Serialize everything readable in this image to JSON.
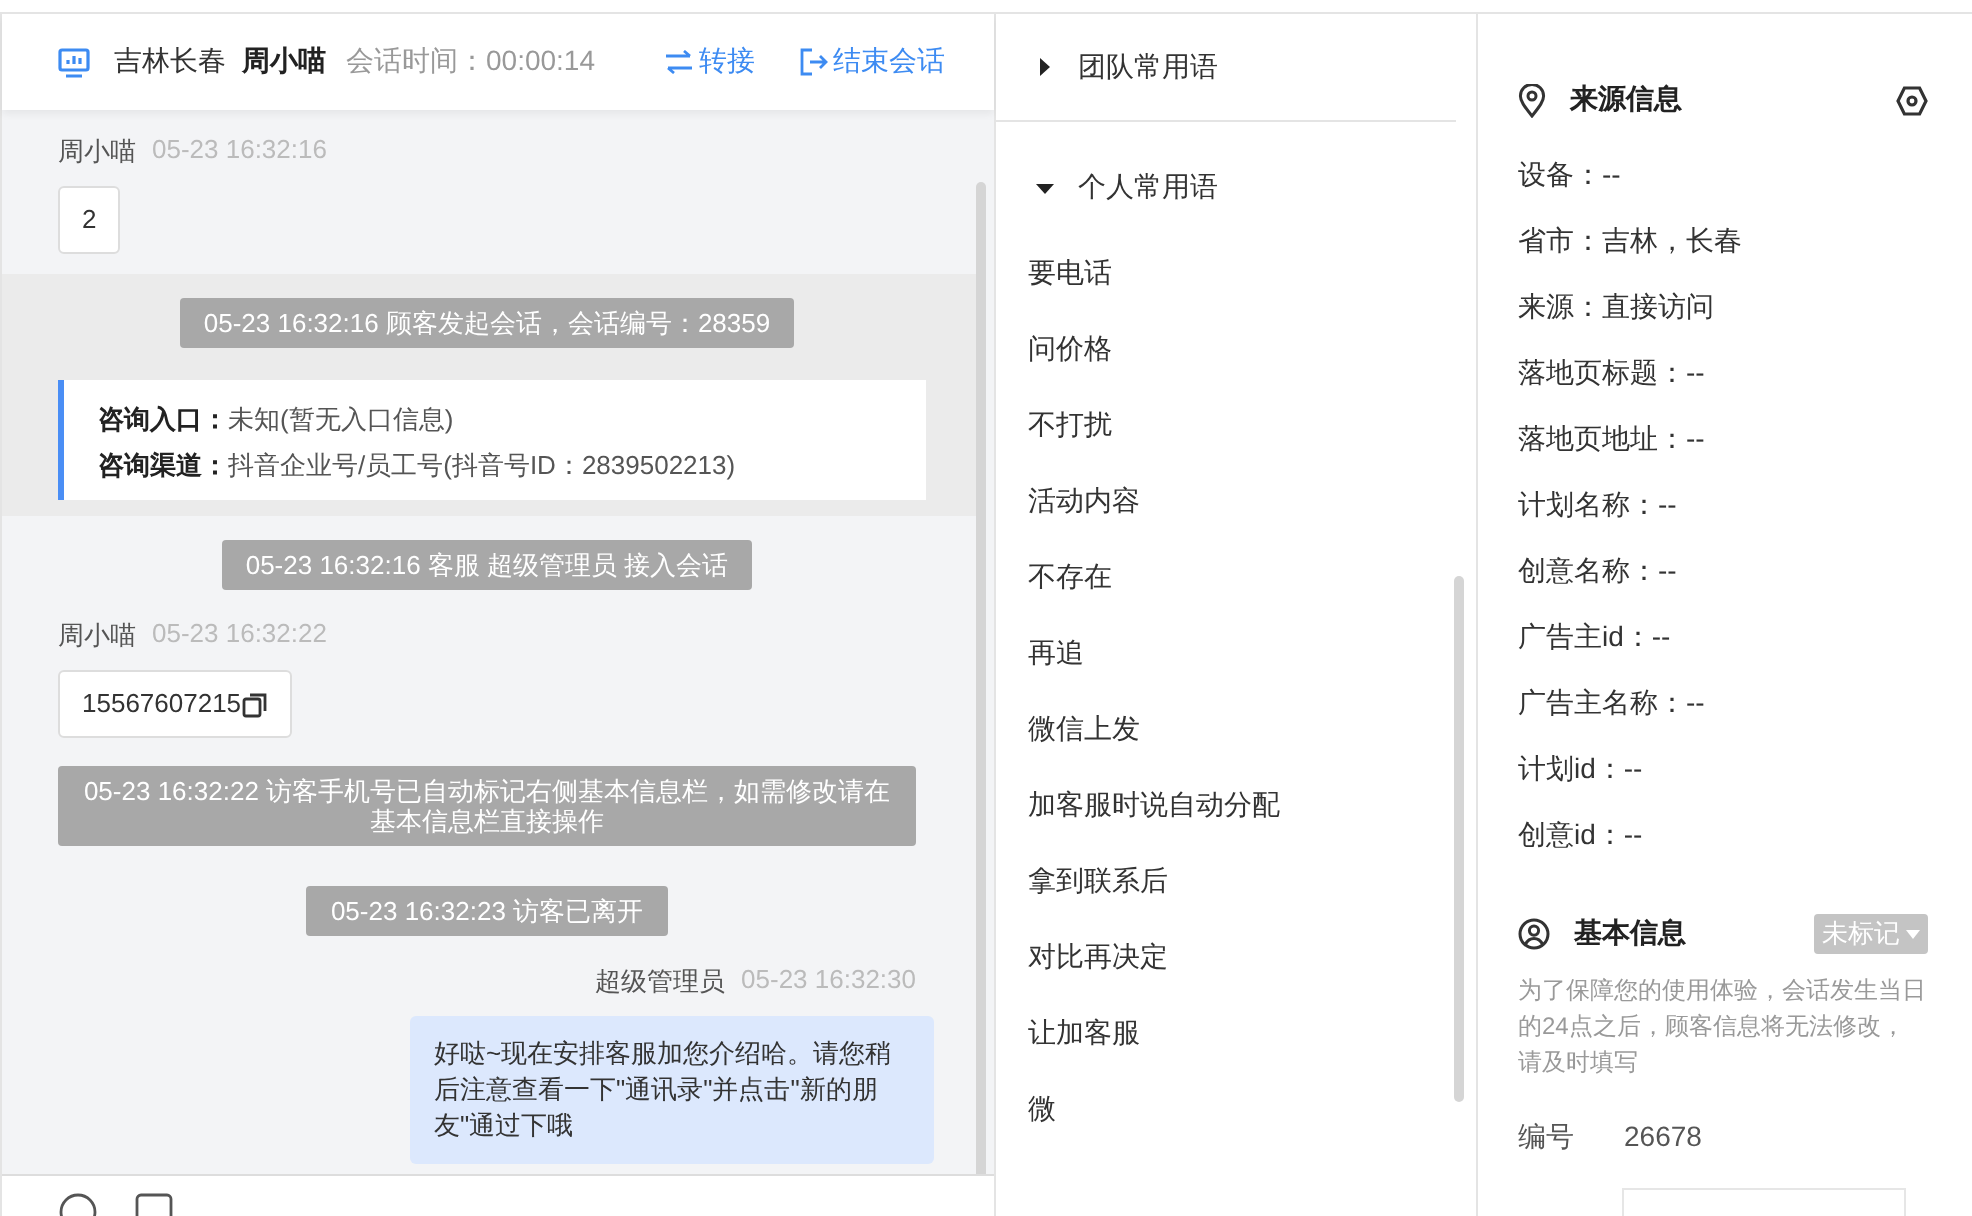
{
  "header": {
    "location": "吉林长春",
    "visitor": "周小喵",
    "duration_label": "会话时间：",
    "duration": "00:00:14",
    "actions": [
      {
        "kind": "transfer",
        "label": "转接"
      },
      {
        "kind": "end",
        "label": "结束会话"
      }
    ]
  },
  "messages": [
    {
      "kind": "customer",
      "sender": "周小喵",
      "time": "05-23 16:32:16",
      "text": "2",
      "copyable": false
    },
    {
      "kind": "session_start",
      "text": "05-23 16:32:16 顾客发起会话，会话编号：28359",
      "rows": [
        {
          "label": "咨询入口：",
          "value": "未知(暂无入口信息)"
        },
        {
          "label": "咨询渠道：",
          "value": "抖音企业号/员工号(抖音号ID：2839502213)"
        }
      ]
    },
    {
      "kind": "system",
      "text": "05-23 16:32:16 客服 超级管理员 接入会话"
    },
    {
      "kind": "customer",
      "sender": "周小喵",
      "time": "05-23 16:32:22",
      "text": "15567607215",
      "copyable": true
    },
    {
      "kind": "system",
      "text": "05-23 16:32:22 访客手机号已自动标记右侧基本信息栏，如需修改请在基本信息栏直接操作"
    },
    {
      "kind": "system",
      "text": "05-23 16:32:23 访客已离开"
    },
    {
      "kind": "agent",
      "sender": "超级管理员",
      "time": "05-23 16:32:30",
      "text": "好哒~现在安排客服加您介绍哈。请您稍后注意查看一下\"通讯录\"并点击\"新的朋友\"通过下哦"
    }
  ],
  "phrase_groups": [
    {
      "title": "团队常用语",
      "expanded": false
    },
    {
      "title": "个人常用语",
      "expanded": true,
      "items": [
        "要电话",
        "问价格",
        "不打扰",
        "活动内容",
        "不存在",
        "再追",
        "微信上发",
        "加客服时说自动分配",
        "拿到联系后",
        "对比再决定",
        "让加客服",
        "微"
      ]
    }
  ],
  "source_info": {
    "title": "来源信息",
    "rows": [
      "设备：--",
      "省市：吉林，长春",
      "来源：直接访问",
      "落地页标题：--",
      "落地页地址：--",
      "计划名称：--",
      "创意名称：--",
      "广告主id：--",
      "广告主名称：--",
      "计划id：--",
      "创意id：--"
    ]
  },
  "basic_info": {
    "title": "基本信息",
    "tag": "未标记",
    "note": "为了保障您的使用体验，会话发生当日的24点之后，顾客信息将无法修改，请及时填写",
    "id_label": "编号",
    "id_value": "26678"
  }
}
